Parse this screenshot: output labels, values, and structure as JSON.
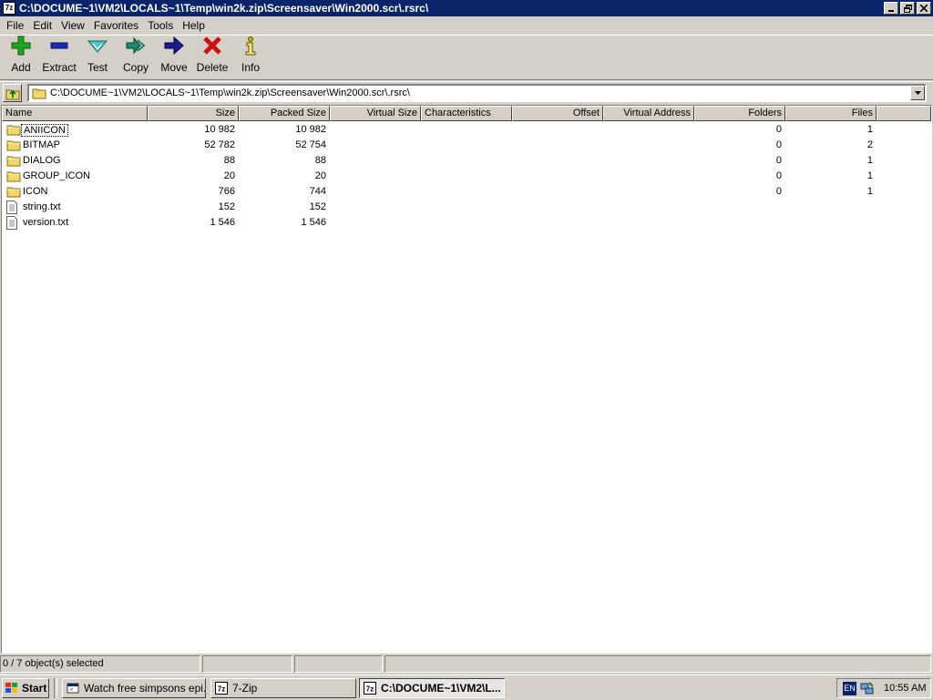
{
  "window": {
    "title": "C:\\DOCUME~1\\VM2\\LOCALS~1\\Temp\\win2k.zip\\Screensaver\\Win2000.scr\\.rsrc\\",
    "app_icon": "7z"
  },
  "menu": [
    "File",
    "Edit",
    "View",
    "Favorites",
    "Tools",
    "Help"
  ],
  "toolbar": [
    {
      "label": "Add",
      "icon": "plus-icon",
      "color": "#1fa81f"
    },
    {
      "label": "Extract",
      "icon": "minus-icon",
      "color": "#1a2bb5"
    },
    {
      "label": "Test",
      "icon": "check-icon",
      "color": "#3cc8c8"
    },
    {
      "label": "Copy",
      "icon": "double-arrow-icon",
      "color": "#1e8a6e"
    },
    {
      "label": "Move",
      "icon": "arrow-right-icon",
      "color": "#1a1a8a"
    },
    {
      "label": "Delete",
      "icon": "x-icon",
      "color": "#d01010"
    },
    {
      "label": "Info",
      "icon": "info-icon",
      "color": "#c8b000"
    }
  ],
  "address": {
    "path": "C:\\DOCUME~1\\VM2\\LOCALS~1\\Temp\\win2k.zip\\Screensaver\\Win2000.scr\\.rsrc\\"
  },
  "columns": [
    "Name",
    "Size",
    "Packed Size",
    "Virtual Size",
    "Characteristics",
    "Offset",
    "Virtual Address",
    "Folders",
    "Files"
  ],
  "files": [
    {
      "name": "ANIICON",
      "type": "folder",
      "size": "10 982",
      "packed": "10 982",
      "folders": "0",
      "files": "1"
    },
    {
      "name": "BITMAP",
      "type": "folder",
      "size": "52 782",
      "packed": "52 754",
      "folders": "0",
      "files": "2"
    },
    {
      "name": "DIALOG",
      "type": "folder",
      "size": "88",
      "packed": "88",
      "folders": "0",
      "files": "1"
    },
    {
      "name": "GROUP_ICON",
      "type": "folder",
      "size": "20",
      "packed": "20",
      "folders": "0",
      "files": "1"
    },
    {
      "name": "ICON",
      "type": "folder",
      "size": "766",
      "packed": "744",
      "folders": "0",
      "files": "1"
    },
    {
      "name": "string.txt",
      "type": "file",
      "size": "152",
      "packed": "152",
      "folders": "",
      "files": ""
    },
    {
      "name": "version.txt",
      "type": "file",
      "size": "1 546",
      "packed": "1 546",
      "folders": "",
      "files": ""
    }
  ],
  "status": {
    "selected": "0 / 7 object(s) selected"
  },
  "taskbar": {
    "start": "Start",
    "tasks": [
      {
        "label": "Watch free simpsons epi...",
        "active": false
      },
      {
        "label": "7-Zip",
        "active": false
      },
      {
        "label": "C:\\DOCUME~1\\VM2\\L...",
        "active": true
      }
    ],
    "lang": "EN",
    "clock": "10:55 AM"
  }
}
